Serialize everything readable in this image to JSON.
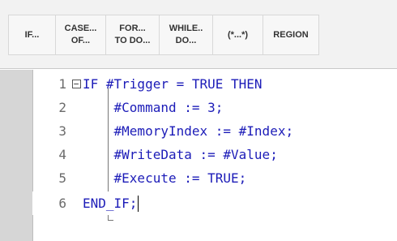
{
  "toolbar": {
    "buttons": [
      {
        "line1": "IF...",
        "line2": ""
      },
      {
        "line1": "CASE...",
        "line2": "OF..."
      },
      {
        "line1": "FOR...",
        "line2": "TO DO..."
      },
      {
        "line1": "WHILE..",
        "line2": "DO..."
      },
      {
        "line1": "(*...*)",
        "line2": ""
      },
      {
        "line1": "REGION",
        "line2": ""
      }
    ]
  },
  "editor": {
    "lines": [
      {
        "num": "1",
        "code": "IF #Trigger = TRUE THEN"
      },
      {
        "num": "2",
        "code": "    #Command := 3;"
      },
      {
        "num": "3",
        "code": "    #MemoryIndex := #Index;"
      },
      {
        "num": "4",
        "code": "    #WriteData := #Value;"
      },
      {
        "num": "5",
        "code": "    #Execute := TRUE;"
      },
      {
        "num": "6",
        "code": "END_IF;"
      }
    ],
    "fold_symbol": "−"
  },
  "colors": {
    "keyword": "#1c1cb8",
    "line_number": "#6b6b6b",
    "gutter": "#d6d6d6"
  }
}
